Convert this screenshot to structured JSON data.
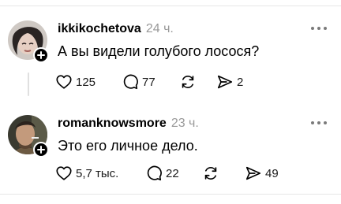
{
  "posts": [
    {
      "username": "ikkikochetova",
      "time": "24 ч.",
      "text": "А вы видели голубого лосося?",
      "likes": "125",
      "comments": "77",
      "shares": "2"
    },
    {
      "username": "romanknowsmore",
      "time": "23 ч.",
      "text": "Это его личное дело.",
      "likes": "5,7 тыс.",
      "comments": "22",
      "shares": "49"
    }
  ],
  "icons": {
    "like": "heart-icon",
    "comment": "speech-bubble-icon",
    "repost": "repost-arrows-icon",
    "share": "send-icon",
    "more": "more-dots-icon",
    "follow": "plus-icon"
  }
}
